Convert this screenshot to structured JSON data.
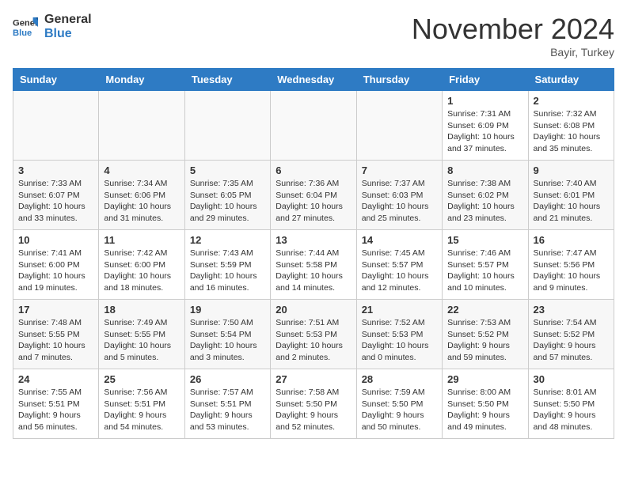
{
  "header": {
    "logo_line1": "General",
    "logo_line2": "Blue",
    "month_title": "November 2024",
    "location": "Bayir, Turkey"
  },
  "days_of_week": [
    "Sunday",
    "Monday",
    "Tuesday",
    "Wednesday",
    "Thursday",
    "Friday",
    "Saturday"
  ],
  "weeks": [
    [
      {
        "day": "",
        "info": ""
      },
      {
        "day": "",
        "info": ""
      },
      {
        "day": "",
        "info": ""
      },
      {
        "day": "",
        "info": ""
      },
      {
        "day": "",
        "info": ""
      },
      {
        "day": "1",
        "info": "Sunrise: 7:31 AM\nSunset: 6:09 PM\nDaylight: 10 hours and 37 minutes."
      },
      {
        "day": "2",
        "info": "Sunrise: 7:32 AM\nSunset: 6:08 PM\nDaylight: 10 hours and 35 minutes."
      }
    ],
    [
      {
        "day": "3",
        "info": "Sunrise: 7:33 AM\nSunset: 6:07 PM\nDaylight: 10 hours and 33 minutes."
      },
      {
        "day": "4",
        "info": "Sunrise: 7:34 AM\nSunset: 6:06 PM\nDaylight: 10 hours and 31 minutes."
      },
      {
        "day": "5",
        "info": "Sunrise: 7:35 AM\nSunset: 6:05 PM\nDaylight: 10 hours and 29 minutes."
      },
      {
        "day": "6",
        "info": "Sunrise: 7:36 AM\nSunset: 6:04 PM\nDaylight: 10 hours and 27 minutes."
      },
      {
        "day": "7",
        "info": "Sunrise: 7:37 AM\nSunset: 6:03 PM\nDaylight: 10 hours and 25 minutes."
      },
      {
        "day": "8",
        "info": "Sunrise: 7:38 AM\nSunset: 6:02 PM\nDaylight: 10 hours and 23 minutes."
      },
      {
        "day": "9",
        "info": "Sunrise: 7:40 AM\nSunset: 6:01 PM\nDaylight: 10 hours and 21 minutes."
      }
    ],
    [
      {
        "day": "10",
        "info": "Sunrise: 7:41 AM\nSunset: 6:00 PM\nDaylight: 10 hours and 19 minutes."
      },
      {
        "day": "11",
        "info": "Sunrise: 7:42 AM\nSunset: 6:00 PM\nDaylight: 10 hours and 18 minutes."
      },
      {
        "day": "12",
        "info": "Sunrise: 7:43 AM\nSunset: 5:59 PM\nDaylight: 10 hours and 16 minutes."
      },
      {
        "day": "13",
        "info": "Sunrise: 7:44 AM\nSunset: 5:58 PM\nDaylight: 10 hours and 14 minutes."
      },
      {
        "day": "14",
        "info": "Sunrise: 7:45 AM\nSunset: 5:57 PM\nDaylight: 10 hours and 12 minutes."
      },
      {
        "day": "15",
        "info": "Sunrise: 7:46 AM\nSunset: 5:57 PM\nDaylight: 10 hours and 10 minutes."
      },
      {
        "day": "16",
        "info": "Sunrise: 7:47 AM\nSunset: 5:56 PM\nDaylight: 10 hours and 9 minutes."
      }
    ],
    [
      {
        "day": "17",
        "info": "Sunrise: 7:48 AM\nSunset: 5:55 PM\nDaylight: 10 hours and 7 minutes."
      },
      {
        "day": "18",
        "info": "Sunrise: 7:49 AM\nSunset: 5:55 PM\nDaylight: 10 hours and 5 minutes."
      },
      {
        "day": "19",
        "info": "Sunrise: 7:50 AM\nSunset: 5:54 PM\nDaylight: 10 hours and 3 minutes."
      },
      {
        "day": "20",
        "info": "Sunrise: 7:51 AM\nSunset: 5:53 PM\nDaylight: 10 hours and 2 minutes."
      },
      {
        "day": "21",
        "info": "Sunrise: 7:52 AM\nSunset: 5:53 PM\nDaylight: 10 hours and 0 minutes."
      },
      {
        "day": "22",
        "info": "Sunrise: 7:53 AM\nSunset: 5:52 PM\nDaylight: 9 hours and 59 minutes."
      },
      {
        "day": "23",
        "info": "Sunrise: 7:54 AM\nSunset: 5:52 PM\nDaylight: 9 hours and 57 minutes."
      }
    ],
    [
      {
        "day": "24",
        "info": "Sunrise: 7:55 AM\nSunset: 5:51 PM\nDaylight: 9 hours and 56 minutes."
      },
      {
        "day": "25",
        "info": "Sunrise: 7:56 AM\nSunset: 5:51 PM\nDaylight: 9 hours and 54 minutes."
      },
      {
        "day": "26",
        "info": "Sunrise: 7:57 AM\nSunset: 5:51 PM\nDaylight: 9 hours and 53 minutes."
      },
      {
        "day": "27",
        "info": "Sunrise: 7:58 AM\nSunset: 5:50 PM\nDaylight: 9 hours and 52 minutes."
      },
      {
        "day": "28",
        "info": "Sunrise: 7:59 AM\nSunset: 5:50 PM\nDaylight: 9 hours and 50 minutes."
      },
      {
        "day": "29",
        "info": "Sunrise: 8:00 AM\nSunset: 5:50 PM\nDaylight: 9 hours and 49 minutes."
      },
      {
        "day": "30",
        "info": "Sunrise: 8:01 AM\nSunset: 5:50 PM\nDaylight: 9 hours and 48 minutes."
      }
    ]
  ]
}
